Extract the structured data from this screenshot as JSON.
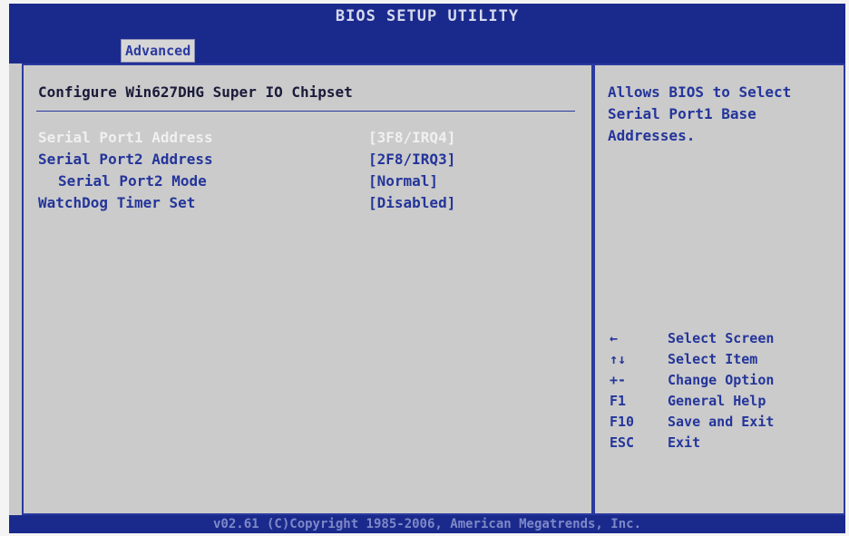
{
  "title": "BIOS SETUP UTILITY",
  "tab": "Advanced",
  "main": {
    "section_title": "Configure Win627DHG Super IO Chipset",
    "items": [
      {
        "label": "Serial Port1 Address",
        "value": "[3F8/IRQ4]"
      },
      {
        "label": "Serial Port2 Address",
        "value": "[2F8/IRQ3]"
      },
      {
        "label": "Serial Port2 Mode",
        "value": "[Normal]"
      },
      {
        "label": "WatchDog Timer Set",
        "value": "[Disabled]"
      }
    ]
  },
  "help": {
    "text": "Allows BIOS to Select Serial Port1 Base Addresses.",
    "keys": [
      {
        "key": "←",
        "action": "Select Screen"
      },
      {
        "key": "↑↓",
        "action": "Select Item"
      },
      {
        "key": "+-",
        "action": "Change Option"
      },
      {
        "key": "F1",
        "action": "General Help"
      },
      {
        "key": "F10",
        "action": "Save and Exit"
      },
      {
        "key": "ESC",
        "action": "Exit"
      }
    ]
  },
  "footer": "v02.61 (C)Copyright 1985-2006, American Megatrends, Inc."
}
